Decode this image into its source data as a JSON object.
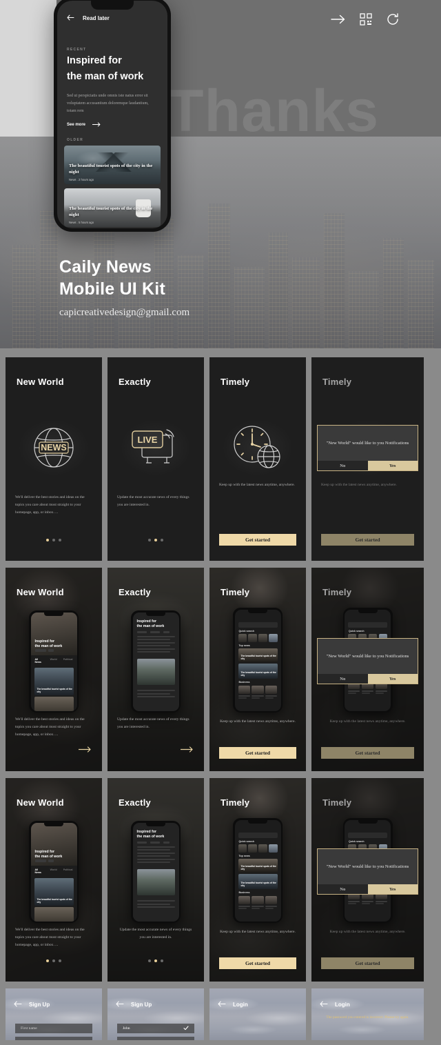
{
  "toolbar": {
    "icons": [
      {
        "name": "arrow-right-icon",
        "label": "Next"
      },
      {
        "name": "qr-code-icon",
        "label": "QR Code"
      },
      {
        "name": "refresh-icon",
        "label": "Refresh"
      }
    ]
  },
  "hero": {
    "watermark": "Thanks",
    "title_line1": "Caily News",
    "title_line2": "Mobile UI Kit",
    "email": "capicreativedesign@gmail.com"
  },
  "hero_phone": {
    "nav_back": "back-arrow-icon",
    "nav_title": "Read later",
    "eyebrow": "RECENT",
    "headline_line1": "Inspired for",
    "headline_line2": "the man of work",
    "body": "Sed ut perspiciatis unde omnis iste natus error sit voluptatem accusantium doloremque laudantium, totam rem",
    "see_more": "See more",
    "older_label": "OLDER",
    "cards": [
      {
        "caption": "The beautiful tourist spots of the city in the night",
        "sub": "News . 2 hours ago"
      },
      {
        "caption": "The beautiful tourist spots of the city in the night",
        "sub": "News . 5 hours ago"
      }
    ]
  },
  "cards": {
    "new_world": {
      "title": "New World",
      "desc": "We'll deliver the best stories and ideas on the topics you care about most straight to your homepage, app, or inbox….",
      "icon": "globe-news-icon",
      "icon_text": "NEWS"
    },
    "exactly": {
      "title": "Exactly",
      "desc": "Update the most accurate news of every things you are interested in.",
      "icon": "live-tv-icon",
      "icon_text": "LIVE"
    },
    "timely": {
      "title": "Timely",
      "desc": "Keep up with the latest news anytime, anywhere.",
      "icon": "clock-globe-icon",
      "button": "Get started"
    }
  },
  "dialog": {
    "message": "\"New World\" would like to you Notifications",
    "no": "No",
    "yes": "Yes"
  },
  "mini_phone": {
    "headline_line1": "Inspired for",
    "headline_line2": "the man of work",
    "tabs": [
      "All News",
      "World",
      "Political"
    ],
    "section_quick": "Quick search",
    "section_top": "Top news",
    "section_business": "Business",
    "card_caption": "The beautiful tourist spots of the city"
  },
  "forms": [
    {
      "nav_title": "Sign Up",
      "fields": [
        {
          "value": "First name",
          "filled": false,
          "check": false
        }
      ]
    },
    {
      "nav_title": "Sign Up",
      "fields": [
        {
          "value": "John",
          "filled": true,
          "check": true
        }
      ]
    },
    {
      "nav_title": "Login",
      "fields": []
    },
    {
      "nav_title": "Login",
      "fields": [],
      "error": "The password you entered is incorrect. Please try again."
    }
  ],
  "colors": {
    "accent": "#efd9a8",
    "card_bg": "#1e1e1e",
    "page_bg": "#8a8a8a"
  }
}
